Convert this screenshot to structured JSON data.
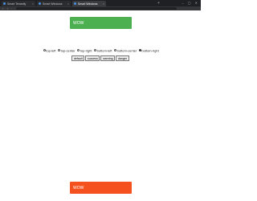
{
  "browser": {
    "tabs": [
      {
        "title": "Smart Tenantly"
      },
      {
        "title": "Smart Windows"
      },
      {
        "title": "Smart Windows"
      }
    ],
    "new_tab": "+",
    "window_controls": "– ▢ ✕"
  },
  "toasts": [
    {
      "text": "WOW",
      "type": "success",
      "color": "#4caf50"
    },
    {
      "text": "WOW",
      "type": "danger",
      "color": "#f5511e"
    }
  ],
  "positions": {
    "options": [
      {
        "label": "top-left",
        "checked": false
      },
      {
        "label": "top-center",
        "checked": false
      },
      {
        "label": "top-right",
        "checked": false
      },
      {
        "label": "bottom-left",
        "checked": false
      },
      {
        "label": "bottom-center",
        "checked": false
      },
      {
        "label": "bottom-right",
        "checked": true
      }
    ]
  },
  "types": {
    "buttons": [
      "default",
      "success",
      "warning",
      "danger"
    ]
  }
}
